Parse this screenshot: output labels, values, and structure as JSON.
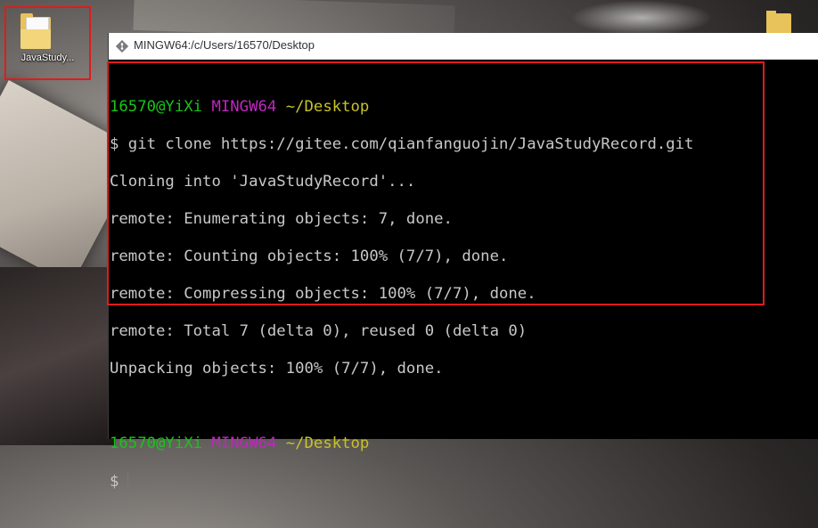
{
  "desktop": {
    "icons": [
      {
        "label": "JavaStudy..."
      }
    ]
  },
  "window": {
    "title": "MINGW64:/c/Users/16570/Desktop"
  },
  "terminal": {
    "prompt1": {
      "user": "16570@YiXi",
      "host": "MINGW64",
      "path": "~/Desktop"
    },
    "command": "$ git clone https://gitee.com/qianfanguojin/JavaStudyRecord.git",
    "output": [
      "Cloning into 'JavaStudyRecord'...",
      "remote: Enumerating objects: 7, done.",
      "remote: Counting objects: 100% (7/7), done.",
      "remote: Compressing objects: 100% (7/7), done.",
      "remote: Total 7 (delta 0), reused 0 (delta 0)",
      "Unpacking objects: 100% (7/7), done."
    ],
    "prompt2": {
      "user": "16570@YiXi",
      "host": "MINGW64",
      "path": "~/Desktop"
    },
    "input_prompt": "$"
  },
  "colors": {
    "user": "#19c419",
    "host": "#bf27bf",
    "path": "#c8c229",
    "text": "#c8c8c8",
    "highlight": "#e01b1b"
  }
}
